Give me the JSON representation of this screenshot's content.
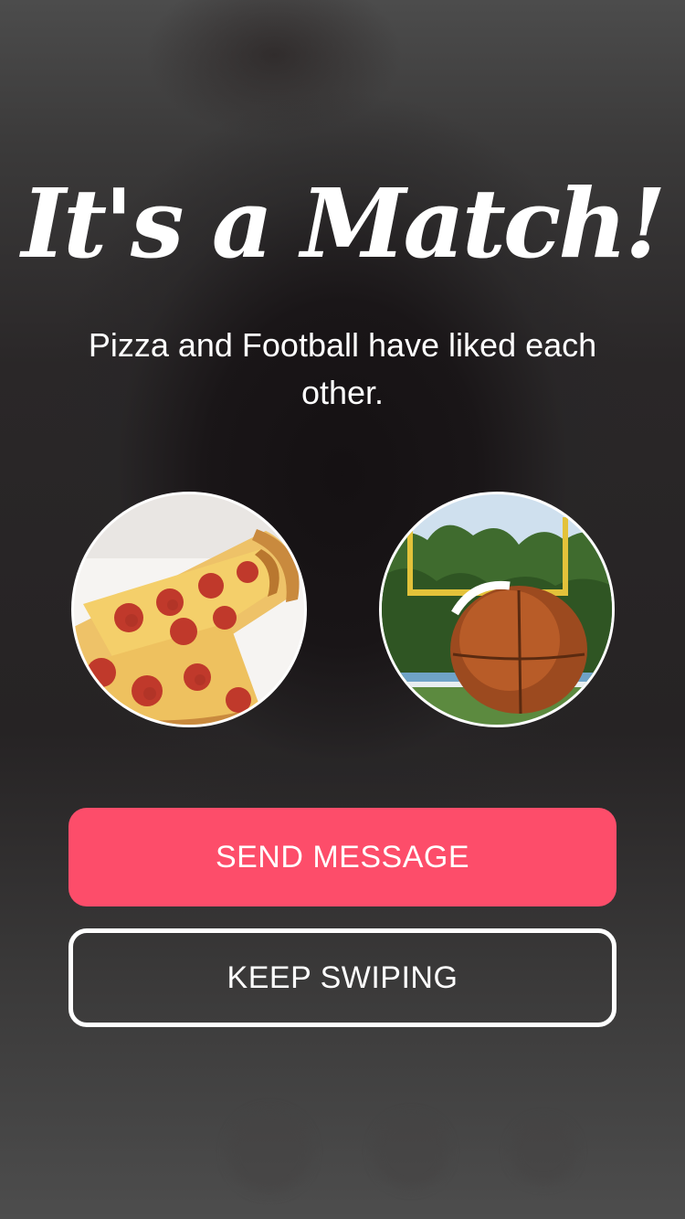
{
  "match_screen": {
    "title": "It's a Match!",
    "subtitle": "Pizza and Football have liked each other.",
    "left_profile": {
      "icon": "pizza-photo"
    },
    "right_profile": {
      "icon": "football-photo"
    }
  },
  "actions": {
    "send_message_label": "SEND MESSAGE",
    "keep_swiping_label": "KEEP SWIPING"
  },
  "colors": {
    "accent": "#fd4d6a",
    "background": "#262324",
    "text": "#ffffff"
  }
}
